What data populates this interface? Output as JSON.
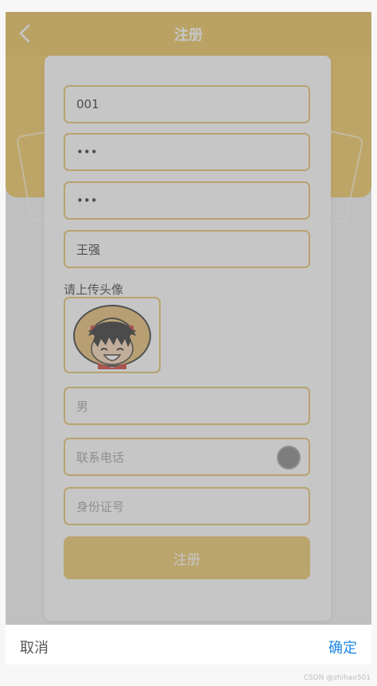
{
  "navbar": {
    "title": "注册"
  },
  "form": {
    "account_value": "001",
    "password_value": "•••",
    "confirm_password_value": "•••",
    "name_value": "王强",
    "avatar_upload_label": "请上传头像",
    "gender_value": "男",
    "phone_placeholder": "联系电话",
    "id_card_placeholder": "身份证号",
    "submit_label": "注册"
  },
  "picker": {
    "cancel_label": "取消",
    "confirm_label": "确定"
  },
  "watermark": "CSDN @zhihao501",
  "colors": {
    "accent": "#e7be4e",
    "confirm": "#1e88e5"
  }
}
